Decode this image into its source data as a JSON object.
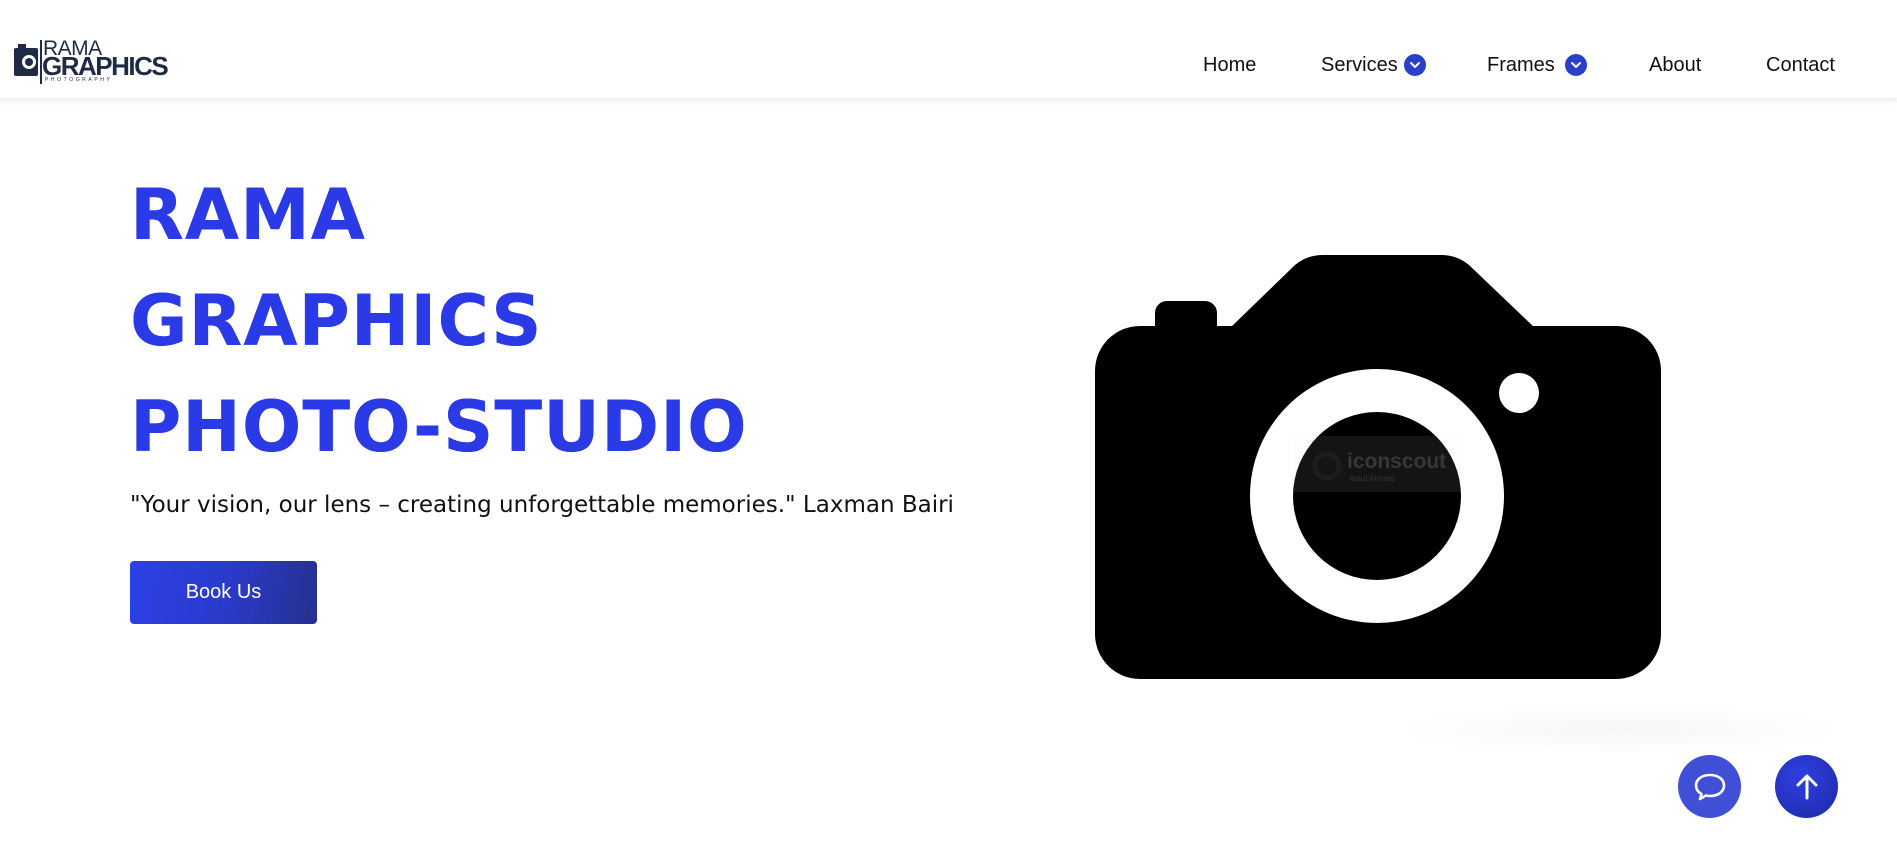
{
  "brand": {
    "line1": "RAMA",
    "line2": "GRAPHICS",
    "line3": "PHOTOGRAPHY",
    "accent": "#2b3fc8",
    "logo_color": "#1f2a44"
  },
  "nav": {
    "items": [
      {
        "label": "Home",
        "has_dropdown": false
      },
      {
        "label": "Services",
        "has_dropdown": true,
        "icon": "chevron-down-icon"
      },
      {
        "label": "Frames",
        "has_dropdown": true,
        "icon": "chevron-down-icon"
      },
      {
        "label": "About",
        "has_dropdown": false
      },
      {
        "label": "Contact",
        "has_dropdown": false
      }
    ]
  },
  "hero": {
    "title_lines": [
      "RAMA",
      "GRAPHICS",
      "PHOTO-STUDIO"
    ],
    "tagline": "\"Your vision, our lens – creating unforgettable memories.\" Laxman Bairi",
    "cta_label": "Book Us",
    "title_colors": [
      "#2a3ae6",
      "#2f33b8"
    ]
  },
  "illustration": {
    "icon": "camera-icon",
    "watermark": "iconscout",
    "watermark_sub": "Ataul Ahmed"
  },
  "floating": {
    "chat_icon": "chat-bubble-icon",
    "top_icon": "arrow-up-icon"
  }
}
